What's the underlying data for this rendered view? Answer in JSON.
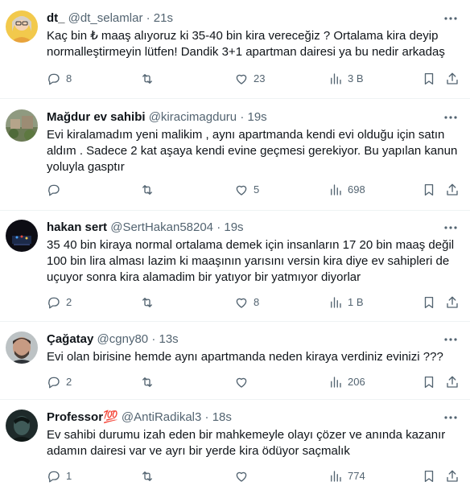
{
  "tweets": [
    {
      "name": "dt_",
      "handle": "@dt_selamlar",
      "time": "21s",
      "text": "Kaç bin ₺ maaş alıyoruz ki 35-40 bin kira vereceğiz ? Ortalama kira deyip normalleştirmeyin lütfen! Dandik 3+1 apartman dairesi ya bu nedir arkadaş",
      "replies": "8",
      "retweets": "",
      "likes": "23",
      "views": "3 B"
    },
    {
      "name": "Mağdur ev sahibi",
      "handle": "@kiracimagduru",
      "time": "19s",
      "text": "Evi kiralamadım yeni malikim , aynı apartmanda kendi evi olduğu için satın aldım . Sadece 2 kat aşaya kendi evine geçmesi gerekiyor. Bu yapılan kanun yoluyla gasptır",
      "replies": "",
      "retweets": "",
      "likes": "5",
      "views": "698"
    },
    {
      "name": "hakan sert",
      "handle": "@SertHakan58204",
      "time": "19s",
      "text": "35 40 bin kiraya normal ortalama demek için insanların 17  20 bin maaş değil 100 bin lira alması lazim ki maaşının yarısını versin kira diye ev sahipleri de uçuyor sonra kira alamadim bir yatıyor bir yatmıyor diyorlar",
      "replies": "2",
      "retweets": "",
      "likes": "8",
      "views": "1 B"
    },
    {
      "name": "Çağatay",
      "handle": "@cgny80",
      "time": "13s",
      "text": "Evi olan birisine hemde aynı apartmanda neden kiraya verdiniz evinizi ???",
      "replies": "2",
      "retweets": "",
      "likes": "",
      "views": "206"
    },
    {
      "name": "Professor💯",
      "handle": "@AntiRadikal3",
      "time": "18s",
      "text": "Ev sahibi durumu izah eden bir mahkemeyle olayı çözer ve anında kazanır adamın dairesi var ve ayrı bir yerde kira ödüyor saçmalık",
      "replies": "1",
      "retweets": "",
      "likes": "",
      "views": "774"
    }
  ],
  "separator": "·",
  "icons": {
    "more": "more-horizontal-icon",
    "reply": "reply-icon",
    "retweet": "retweet-icon",
    "like": "like-heart-icon",
    "views": "views-bar-chart-icon",
    "bookmark": "bookmark-icon",
    "share": "share-icon"
  },
  "colors": {
    "text": "#0f1419",
    "secondary": "#536471",
    "divider": "#eff3f4"
  }
}
